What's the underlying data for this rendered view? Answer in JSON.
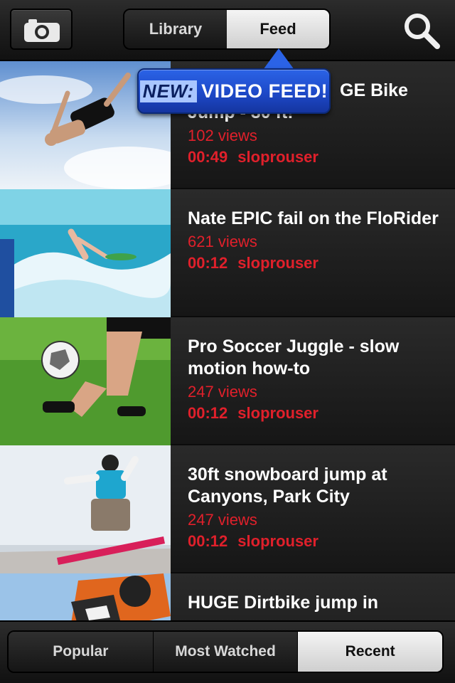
{
  "header": {
    "tabs": [
      {
        "label": "Library",
        "active": false
      },
      {
        "label": "Feed",
        "active": true
      }
    ],
    "left_icon": "camera-icon",
    "right_icon": "search-icon"
  },
  "callout": {
    "new_label": "NEW:",
    "text": "VIDEO FEED!"
  },
  "videos": [
    {
      "title": "HUGE Bike Jump - 30 ft!",
      "title_visible_tail": "GE Bike",
      "title_line2": "Jump - 30 ft!",
      "views": "102 views",
      "duration": "00:49",
      "user": "sloprouser"
    },
    {
      "title": "Nate EPIC fail on the FloRider",
      "views": "621 views",
      "duration": "00:12",
      "user": "sloprouser"
    },
    {
      "title": "Pro Soccer Juggle - slow motion how-to",
      "views": "247 views",
      "duration": "00:12",
      "user": "sloprouser"
    },
    {
      "title": "30ft snowboard jump at Canyons, Park City",
      "views": "247 views",
      "duration": "00:12",
      "user": "sloprouser"
    },
    {
      "title": "HUGE Dirtbike jump in"
    }
  ],
  "footer": {
    "tabs": [
      {
        "label": "Popular",
        "active": false
      },
      {
        "label": "Most Watched",
        "active": false
      },
      {
        "label": "Recent",
        "active": true
      }
    ]
  },
  "colors": {
    "accent_red": "#e0202b",
    "callout_blue": "#1d49c8"
  }
}
